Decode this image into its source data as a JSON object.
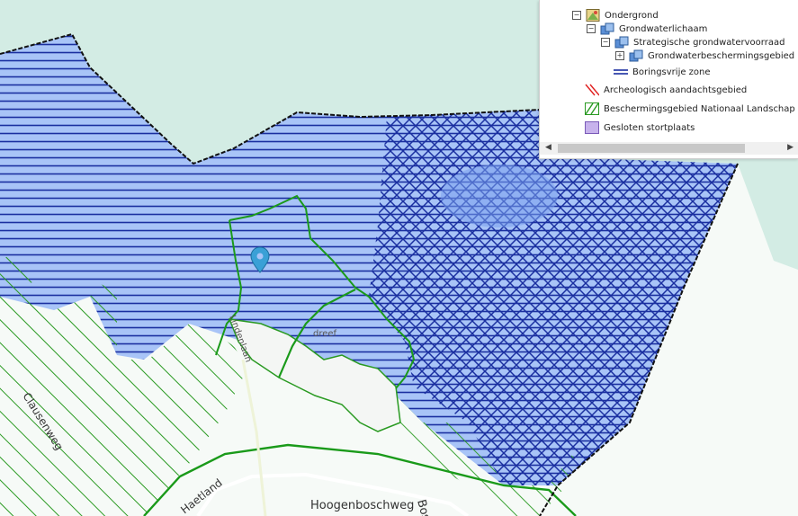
{
  "map": {
    "street_labels": [
      {
        "id": "hoogenboschweg",
        "text": "Hoogenboschweg"
      },
      {
        "id": "haetland",
        "text": "Haetland"
      },
      {
        "id": "clausenweg",
        "text": "Clausenweg"
      },
      {
        "id": "bos",
        "text": "Bos"
      },
      {
        "id": "lindenlaan",
        "text": "Lindenlaan"
      },
      {
        "id": "dreef",
        "text": "dreef"
      }
    ]
  },
  "legend": {
    "items": [
      {
        "label": "Ondergrond",
        "toggle": "−",
        "icon": "layer-group-icon"
      },
      {
        "label": "Grondwaterlichaam",
        "toggle": "−",
        "icon": "sublayer-icon"
      },
      {
        "label": "Strategische grondwatervoorraad",
        "toggle": "−",
        "icon": "sublayer-icon"
      },
      {
        "label": "Grondwaterbeschermingsgebied",
        "toggle": "+",
        "icon": "sublayer-icon"
      },
      {
        "label": "Boringsvrije zone",
        "icon": "blue-line-symbol-icon"
      },
      {
        "label": "Archeologisch aandachtsgebied",
        "icon": "red-hatch-symbol-icon"
      },
      {
        "label": "Beschermingsgebied Nationaal Landschap Zu",
        "icon": "green-hatch-symbol-icon"
      },
      {
        "label": "Gesloten stortplaats",
        "icon": "purple-fill-symbol-icon"
      }
    ],
    "scroll_left": "◀",
    "scroll_right": "▶"
  },
  "colors": {
    "water": "#d3ece4",
    "land": "#ffffff",
    "protected_fill": "#a8c4f7",
    "blue_hatch": "#1a2fa0",
    "green_hatch": "#2a9a22",
    "boundary": "#1a9a1a",
    "marker": "#3aa0d6"
  }
}
